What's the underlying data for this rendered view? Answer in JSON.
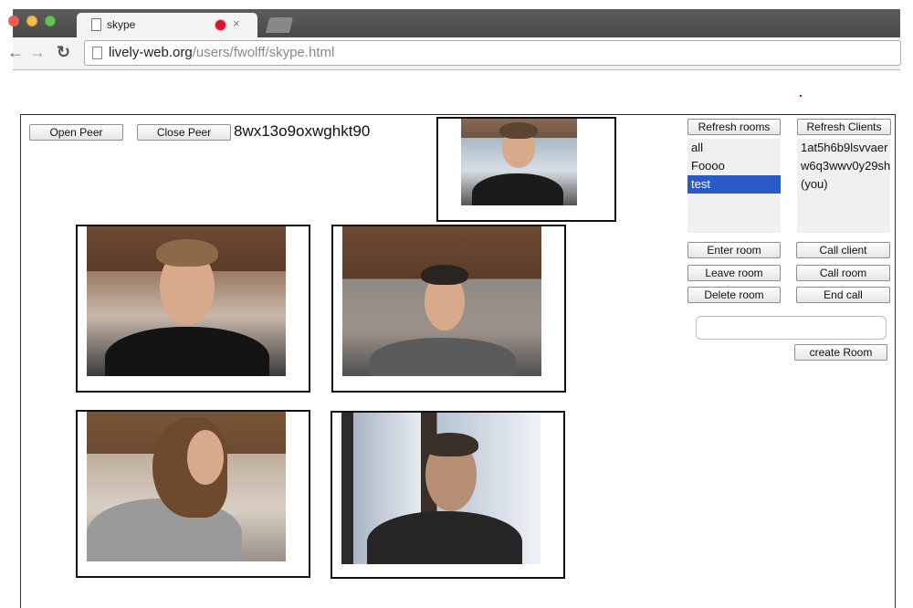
{
  "browser": {
    "tab_title": "skype",
    "url_host": "lively-web.org",
    "url_path": "/users/fwolff/skype.html"
  },
  "peer": {
    "open_label": "Open Peer",
    "close_label": "Close Peer",
    "peer_id": "8wx13o9oxwghkt90"
  },
  "rooms": {
    "refresh_label": "Refresh rooms",
    "items": [
      "all",
      "Foooo",
      "test"
    ],
    "selected": "test",
    "enter_label": "Enter room",
    "leave_label": "Leave room",
    "delete_label": "Delete room",
    "create_label": "create Room",
    "new_room_value": ""
  },
  "clients": {
    "refresh_label": "Refresh Clients",
    "items": [
      "1at5h6b9lsvvaer",
      "w6q3wwv0y29sh",
      "(you)"
    ],
    "call_client_label": "Call client",
    "call_room_label": "Call room",
    "end_call_label": "End call"
  },
  "colors": {
    "selection": "#2a5ac8",
    "recording_indicator": "#e0102a"
  }
}
